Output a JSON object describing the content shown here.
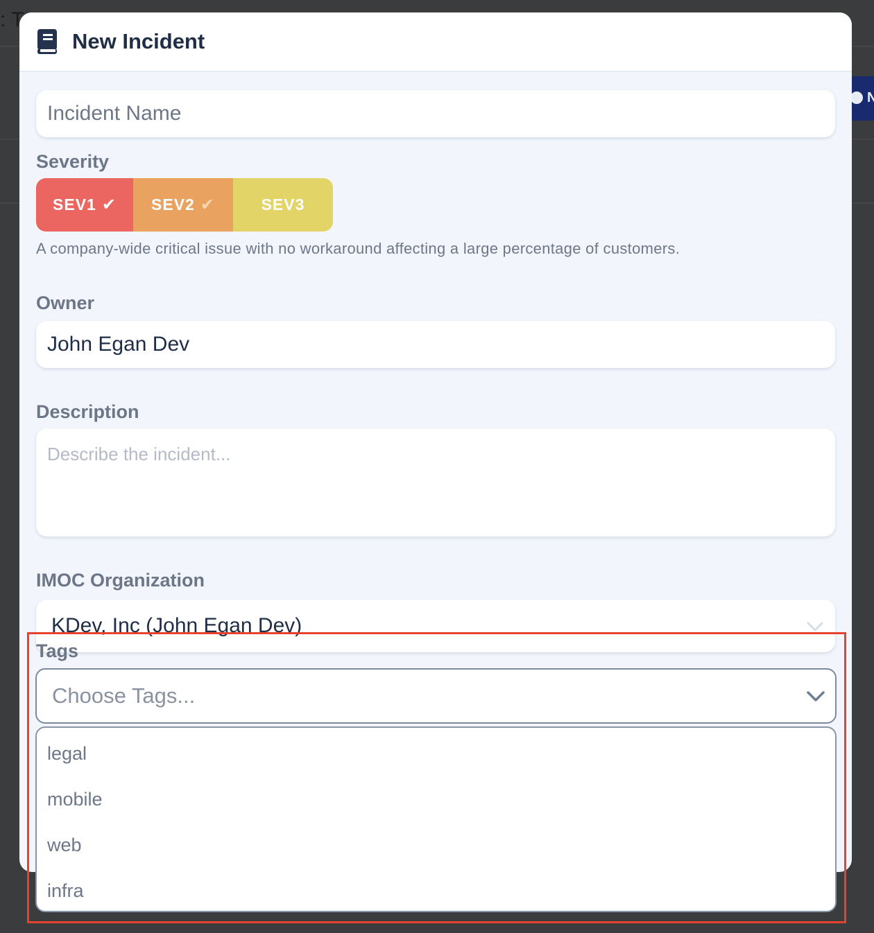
{
  "background": {
    "page_title_fragment": ": T",
    "side_button_fragment": "N"
  },
  "modal": {
    "title": "New Incident",
    "name_field": {
      "placeholder": "Incident Name"
    },
    "severity": {
      "label": "Severity",
      "options": [
        {
          "label": "SEV1",
          "check": "✔",
          "color": "#ec6661",
          "selected": true
        },
        {
          "label": "SEV2",
          "check": "✔",
          "color": "#e9a25f",
          "selected": false
        },
        {
          "label": "SEV3",
          "check": "",
          "color": "#e2d466",
          "selected": false
        }
      ],
      "description": "A company-wide critical issue with no workaround affecting a large percentage of customers."
    },
    "owner": {
      "label": "Owner",
      "value": "John Egan Dev"
    },
    "description": {
      "label": "Description",
      "placeholder": "Describe the incident..."
    },
    "organization": {
      "label": "IMOC Organization",
      "value": "KDev, Inc (John Egan Dev)"
    },
    "tags": {
      "label": "Tags",
      "placeholder": "Choose Tags...",
      "options": [
        "legal",
        "mobile",
        "web",
        "infra"
      ]
    }
  },
  "colors": {
    "accent_highlight": "#e5432e",
    "title_text": "#1f2d45"
  }
}
